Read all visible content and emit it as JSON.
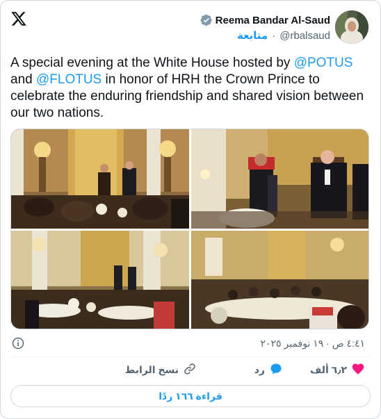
{
  "author": {
    "display_name": "Reema Bandar Al-Saud",
    "handle": "@rbalsaud",
    "follow_label": "متابعة",
    "separator": "·"
  },
  "tweet": {
    "text_parts": {
      "p1": "A special evening at the White House hosted by ",
      "m1": "@POTUS",
      "p2": " and ",
      "m2": "@FLOTUS",
      "p3": " in honor of HRH the Crown Prince to celebrate the enduring friendship and shared vision between our two nations."
    },
    "timestamp": "٤:٤١ ص · ١٩ نوفمبر ٢٠٢٥"
  },
  "actions": {
    "like_count": "٦٫٢ ألف",
    "reply_label": "رد",
    "copy_link_label": "نسخ الرابط",
    "read_replies_label": "قراءة ١٦٦ ردًا"
  },
  "colors": {
    "accent": "#1d9bf0",
    "like": "#f91880",
    "text": "#0f1419",
    "muted": "#536471"
  },
  "icons": [
    "x-logo-icon",
    "verified-badge-icon",
    "info-icon",
    "heart-icon",
    "reply-bubble-icon",
    "link-icon"
  ]
}
